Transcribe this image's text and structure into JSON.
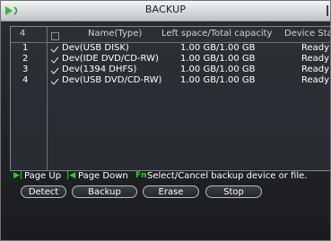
{
  "window": {
    "title": "BACKUP"
  },
  "table": {
    "header": {
      "count": "4",
      "name_label": "Name(Type)",
      "capacity_label": "Left space/Total capacity",
      "status_label": "Device Stat"
    },
    "rows": [
      {
        "index": "1",
        "name": "Dev(USB DISK)",
        "capacity": "1.00 GB/1.00 GB",
        "status": "Ready"
      },
      {
        "index": "2",
        "name": "Dev(IDE DVD/CD-RW)",
        "capacity": "1.00 GB/1.00 GB",
        "status": "Ready"
      },
      {
        "index": "3",
        "name": "Dev(1394 DHFS)",
        "capacity": "1.00 GB/1.00 GB",
        "status": "Ready"
      },
      {
        "index": "4",
        "name": "Dev(USB DVD/CD-RW)",
        "capacity": "1.00 GB/1.00 GB",
        "status": "Ready"
      }
    ]
  },
  "help": {
    "page_up": "Page Up",
    "page_down": "Page Down",
    "select_cancel": "Select/Cancel backup device or file.",
    "icon_up": "▶|",
    "icon_down": "|◀",
    "icon_fn": "Fn"
  },
  "buttons": {
    "detect": "Detect",
    "backup": "Backup",
    "erase": "Erase",
    "stop": "Stop"
  },
  "colors": {
    "accent_green": "#33cc33",
    "text": "#ffffff",
    "border": "#7f858a"
  }
}
